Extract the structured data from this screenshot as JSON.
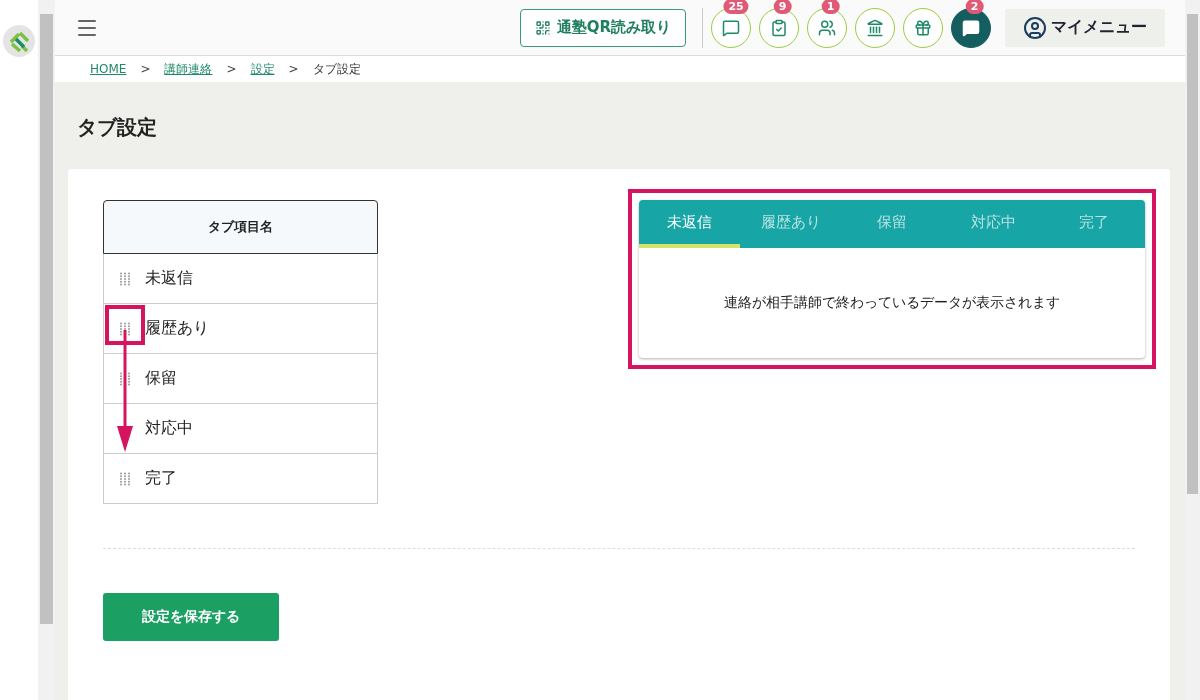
{
  "header": {
    "qr_button": "通塾QR読み取り",
    "icon_buttons": [
      {
        "kind": "chat",
        "badge": "25"
      },
      {
        "kind": "checklist",
        "badge": "9"
      },
      {
        "kind": "people",
        "badge": "1"
      },
      {
        "kind": "building"
      },
      {
        "kind": "gift"
      },
      {
        "kind": "chat_solid",
        "badge": "2"
      }
    ],
    "my_menu": "マイメニュー"
  },
  "breadcrumb": [
    {
      "label": "HOME",
      "link": true
    },
    {
      "separator": ">",
      "label": "講師連絡",
      "link": true
    },
    {
      "separator": ">",
      "label": "設定",
      "link": true
    },
    {
      "separator": ">",
      "label": "タブ設定",
      "link": false
    }
  ],
  "page_title": "タブ設定",
  "tab_table": {
    "column": "タブ項目名",
    "rows": [
      {
        "label": "未返信",
        "handle_visible": true
      },
      {
        "label": "履歴あり",
        "handle_visible": true
      },
      {
        "label": "保留",
        "handle_visible": true
      },
      {
        "label": "対応中",
        "handle_visible": false
      },
      {
        "label": "完了",
        "handle_visible": true
      }
    ]
  },
  "preview": {
    "tabs": [
      {
        "label": "未返信",
        "selected": true
      },
      {
        "label": "履歴あり",
        "selected": false
      },
      {
        "label": "保留",
        "selected": false
      },
      {
        "label": "対応中",
        "selected": false
      },
      {
        "label": "完了",
        "selected": false
      }
    ],
    "message": "連絡が相手講師で終わっているデータが表示されます"
  },
  "save_button": "設定を保存する"
}
